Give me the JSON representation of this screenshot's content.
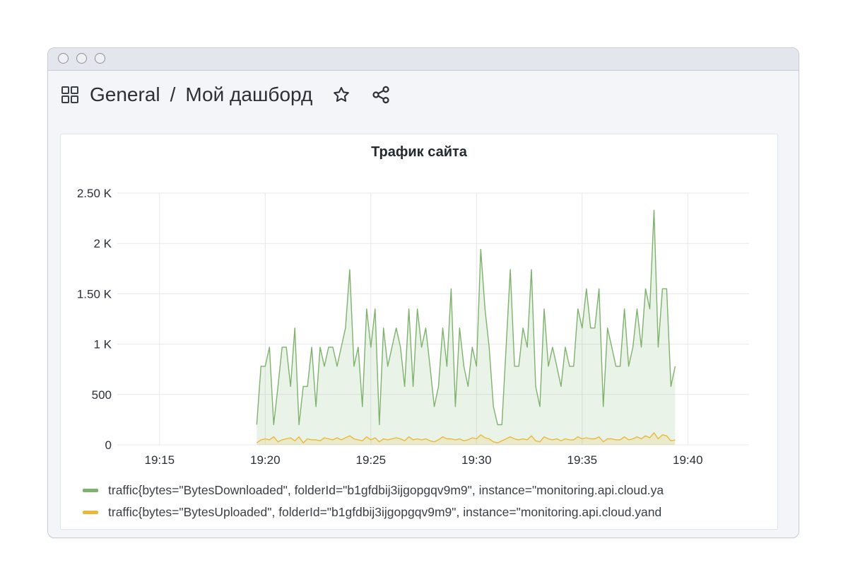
{
  "header": {
    "folder": "General",
    "separator": "/",
    "dashboard": "Мой дашборд"
  },
  "icons": {
    "apps": "apps-grid-icon",
    "star": "star-icon",
    "share": "share-icon"
  },
  "panel": {
    "title": "Трафик сайта"
  },
  "colors": {
    "downloaded": "#7eb26d",
    "uploaded": "#eab839",
    "grid": "#e6e8ec",
    "axis_text": "#2b2f36"
  },
  "chart_data": {
    "type": "area",
    "title": "Трафик сайта",
    "xlabel": "",
    "ylabel": "",
    "grid": true,
    "legend_position": "bottom",
    "x_ticks": [
      "19:15",
      "19:20",
      "19:25",
      "19:30",
      "19:35",
      "19:40"
    ],
    "x_tick_minutes": [
      15,
      20,
      25,
      30,
      35,
      40
    ],
    "x_range_minutes": [
      13.0,
      42.9
    ],
    "y_ticks": [
      "0",
      "500",
      "1 K",
      "1.50 K",
      "2 K",
      "2.50 K"
    ],
    "y_tick_values": [
      0,
      500,
      1000,
      1500,
      2000,
      2500
    ],
    "ylim": [
      0,
      2500
    ],
    "x_start": "19:19:36",
    "x_step_seconds": 12,
    "series": [
      {
        "name": "traffic{bytes=\"BytesDownloaded\", folderId=\"b1gfdbij3ijgopgqv9m9\", instance=\"monitoring.api.cloud.ya",
        "color": "#7eb26d",
        "values": [
          200,
          780,
          780,
          970,
          200,
          570,
          970,
          970,
          580,
          1160,
          200,
          580,
          580,
          970,
          380,
          970,
          780,
          970,
          970,
          780,
          970,
          1160,
          1740,
          780,
          970,
          380,
          1350,
          970,
          1350,
          200,
          1160,
          780,
          970,
          1160,
          970,
          580,
          1350,
          580,
          1350,
          970,
          1160,
          780,
          380,
          580,
          1160,
          780,
          1550,
          380,
          1160,
          780,
          580,
          970,
          780,
          1940,
          1350,
          970,
          380,
          200,
          200,
          970,
          1740,
          780,
          780,
          1160,
          970,
          1740,
          580,
          380,
          1350,
          780,
          970,
          780,
          580,
          970,
          780,
          780,
          1350,
          1160,
          1550,
          1160,
          1160,
          1550,
          380,
          1160,
          970,
          780,
          780,
          1350,
          780,
          970,
          1350,
          970,
          1550,
          1350,
          2330,
          970,
          1550,
          1550,
          580,
          780
        ]
      },
      {
        "name": "traffic{bytes=\"BytesUploaded\", folderId=\"b1gfdbij3ijgopgqv9m9\", instance=\"monitoring.api.cloud.yand",
        "color": "#eab839",
        "values": [
          20,
          50,
          60,
          50,
          80,
          30,
          50,
          60,
          70,
          40,
          80,
          20,
          60,
          50,
          50,
          40,
          70,
          60,
          50,
          70,
          50,
          70,
          90,
          60,
          50,
          40,
          80,
          50,
          70,
          30,
          60,
          50,
          60,
          70,
          60,
          40,
          80,
          50,
          60,
          50,
          60,
          40,
          30,
          50,
          80,
          60,
          60,
          50,
          60,
          40,
          50,
          70,
          60,
          100,
          70,
          60,
          30,
          20,
          40,
          60,
          80,
          60,
          50,
          60,
          50,
          90,
          40,
          30,
          80,
          60,
          50,
          60,
          40,
          60,
          50,
          50,
          80,
          60,
          70,
          60,
          60,
          80,
          30,
          60,
          60,
          50,
          50,
          80,
          50,
          60,
          80,
          60,
          90,
          70,
          120,
          60,
          100,
          90,
          40,
          50
        ]
      }
    ]
  }
}
